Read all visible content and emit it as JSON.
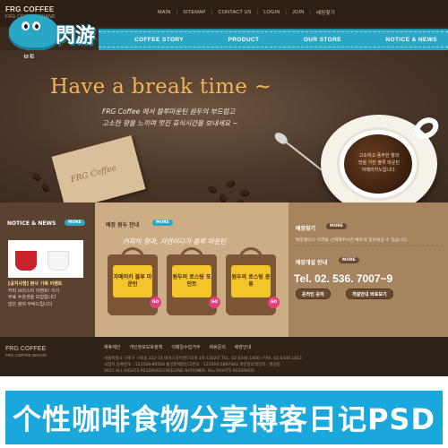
{
  "brand": {
    "name": "FRG COFFEE",
    "tag": "FRG COFFEE BRAND"
  },
  "top_nav": [
    "MAIN",
    "SITEMAP",
    "CONTACT US",
    "LOGIN",
    "JOIN",
    "배장찾기"
  ],
  "main_nav": [
    "COFFEE STORY",
    "PRODUCT",
    "OUR STORE",
    "NOTICE & NEWS"
  ],
  "logo": {
    "text": "閃游",
    "small": "ㅂㅌ"
  },
  "hero": {
    "headline": "Have a break time ~",
    "tagline": [
      "FRG Coffee 에서 블루마운틴 원두의 부드럽고",
      "고소한 향을 느끼며 멋진 휴식시간을 보내세요 ~"
    ],
    "cup_text": [
      "고소하고 풍부한 향과",
      "맛을 가진 블루 마운틴",
      "아메리카노입니다."
    ],
    "paper_script": "FRG Coffee"
  },
  "notice": {
    "title": "NOTICE & NEWS",
    "more": "MORE",
    "headline": "[공지사항] 본사 기획 이벤트",
    "lines": [
      "커피 브리스타 이벤트! 이기",
      "무료 수강생을 모집합니다",
      "많은 참여 부탁드립니다"
    ]
  },
  "beans": {
    "title": "배장 원두 안내",
    "more": "MORE",
    "quote": "커피의 향과, 자연이다가 블루 마운틴",
    "items": [
      {
        "label": "자메이카 블루 마운틴",
        "go": "GO"
      },
      {
        "label": "원두의 로스팅 포인트",
        "go": "GO"
      },
      {
        "label": "원두의 로스팅 종류",
        "go": "GO"
      }
    ]
  },
  "store": {
    "find_title": "배장찾기",
    "find_more": "MORE",
    "find_text": "배장별이나 지역을 선택해주시면 빠르게 찾아보실 수 있습니다.",
    "open_title": "배장개설 안내",
    "open_more": "MORE",
    "tel": "Tel. 02. 536. 7007~9",
    "btn_online": "온라인 문의",
    "btn_guide": "개설안내 바로보기"
  },
  "footer": {
    "links": [
      "제휴제안",
      "개인정보보호정책",
      "이메일수집거부",
      "제휴문의",
      "배장안내"
    ],
    "info": [
      "서울특별시 구로구 구로동 222-14 에이스하이엔드타워 2차 1302호    TEL. 02.6340.1800 / FAX. 02.6340.1812",
      "사업자 등록번호 : 123568-89568  통신판매업신고번호 : 123569-5897463  개인정보책임자 : 홍길동",
      "2011 ALL RIGHTS RESERVED.FREEGINE NATIONER. ALL RIGHTS RESERVED"
    ]
  },
  "banner": {
    "text": "个性咖啡食物分享博客日记PSD"
  },
  "colors": {
    "accent": "#2aa7c4",
    "banner": "#1aa7db",
    "headline": "#f0b35c"
  }
}
